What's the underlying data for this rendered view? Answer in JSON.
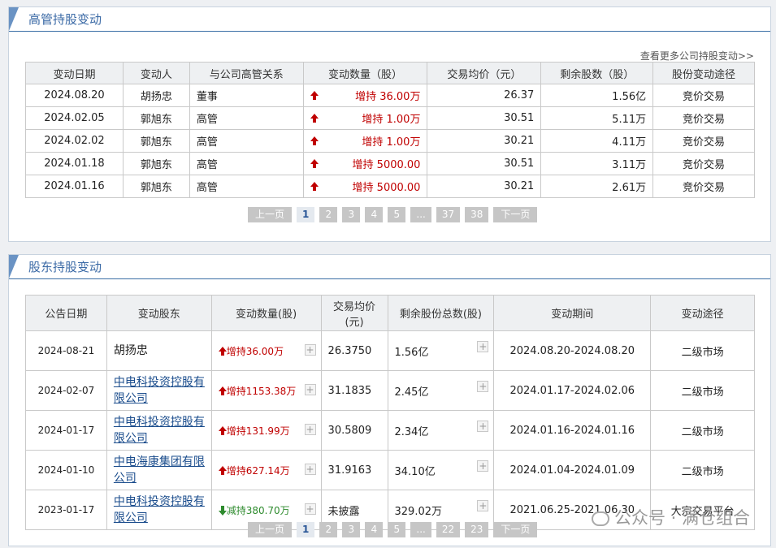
{
  "panel1": {
    "title": "高管持股变动",
    "more_link": "查看更多公司持股变动>>",
    "headers": [
      "变动日期",
      "变动人",
      "与公司高管关系",
      "变动数量（股）",
      "交易均价（元）",
      "剩余股数（股）",
      "股份变动途径"
    ],
    "rows": [
      {
        "date": "2024.08.20",
        "person": "胡扬忠",
        "relation": "董事",
        "qty": "增持 36.00万",
        "price": "26.37",
        "remain": "1.56亿",
        "way": "竞价交易"
      },
      {
        "date": "2024.02.05",
        "person": "郭旭东",
        "relation": "高管",
        "qty": "增持 1.00万",
        "price": "30.51",
        "remain": "5.11万",
        "way": "竞价交易"
      },
      {
        "date": "2024.02.02",
        "person": "郭旭东",
        "relation": "高管",
        "qty": "增持 1.00万",
        "price": "30.21",
        "remain": "4.11万",
        "way": "竞价交易"
      },
      {
        "date": "2024.01.18",
        "person": "郭旭东",
        "relation": "高管",
        "qty": "增持 5000.00",
        "price": "30.51",
        "remain": "3.11万",
        "way": "竞价交易"
      },
      {
        "date": "2024.01.16",
        "person": "郭旭东",
        "relation": "高管",
        "qty": "增持 5000.00",
        "price": "30.21",
        "remain": "2.61万",
        "way": "竞价交易"
      }
    ],
    "pager": [
      "上一页",
      "1",
      "2",
      "3",
      "4",
      "5",
      "...",
      "37",
      "38",
      "下一页"
    ]
  },
  "panel2": {
    "title": "股东持股变动",
    "headers": [
      "公告日期",
      "变动股东",
      "变动数量(股)",
      "交易均价\n(元)",
      "剩余股份总数(股)",
      "变动期间",
      "变动途径"
    ],
    "rows": [
      {
        "date": "2024-08-21",
        "holder": "胡扬忠",
        "holder_link": false,
        "qty": "增持36.00万",
        "dir": "up",
        "price": "26.3750",
        "remain": "1.56亿",
        "period": "2024.08.20-2024.08.20",
        "way": "二级市场"
      },
      {
        "date": "2024-02-07",
        "holder": "中电科投资控股有限公司",
        "holder_link": true,
        "qty": "增持1153.38万",
        "dir": "up",
        "price": "31.1835",
        "remain": "2.45亿",
        "period": "2024.01.17-2024.02.06",
        "way": "二级市场"
      },
      {
        "date": "2024-01-17",
        "holder": "中电科投资控股有限公司",
        "holder_link": true,
        "qty": "增持131.99万",
        "dir": "up",
        "price": "30.5809",
        "remain": "2.34亿",
        "period": "2024.01.16-2024.01.16",
        "way": "二级市场"
      },
      {
        "date": "2024-01-10",
        "holder": "中电海康集团有限公司",
        "holder_link": true,
        "qty": "增持627.14万",
        "dir": "up",
        "price": "31.9163",
        "remain": "34.10亿",
        "period": "2024.01.04-2024.01.09",
        "way": "二级市场"
      },
      {
        "date": "2023-01-17",
        "holder": "中电科投资控股有限公司",
        "holder_link": true,
        "qty": "减持380.70万",
        "dir": "down",
        "price": "未披露",
        "remain": "329.02万",
        "period": "2021.06.25-2021.06.30",
        "way": "大宗交易平台"
      }
    ],
    "plus_symbol": "+",
    "pager": [
      "上一页",
      "1",
      "2",
      "3",
      "4",
      "5",
      "...",
      "22",
      "23",
      "下一页"
    ]
  },
  "watermark": "公众号 · 满仓组合",
  "colors": {
    "accent": "#3b6aa6",
    "tab": "#6a93c4",
    "up": "#c00000",
    "down": "#2e8b2e"
  }
}
